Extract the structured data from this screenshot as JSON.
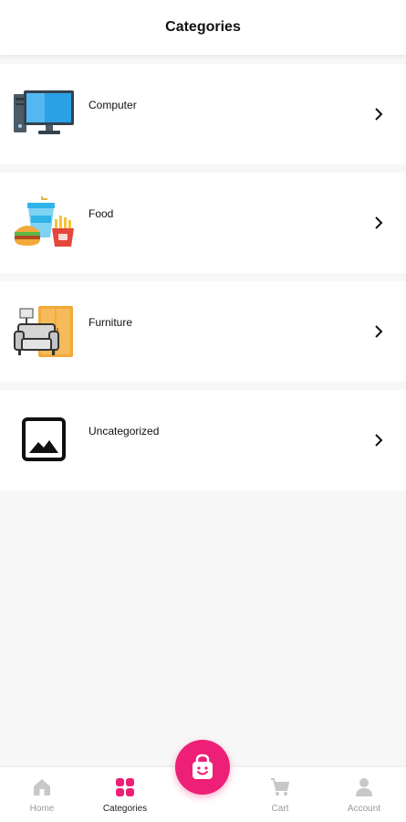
{
  "header": {
    "title": "Categories"
  },
  "categories": [
    {
      "label": "Computer",
      "icon": "computer-icon"
    },
    {
      "label": "Food",
      "icon": "food-icon"
    },
    {
      "label": "Furniture",
      "icon": "furniture-icon"
    },
    {
      "label": "Uncategorized",
      "icon": "image-placeholder-icon"
    }
  ],
  "bottom_nav": {
    "items": [
      {
        "label": "Home",
        "icon": "home-icon",
        "active": false
      },
      {
        "label": "Categories",
        "icon": "grid-icon",
        "active": true
      },
      {
        "label": "Cart",
        "icon": "cart-icon",
        "active": false
      },
      {
        "label": "Account",
        "icon": "account-icon",
        "active": false
      }
    ],
    "fab_icon": "shopping-bag-icon"
  },
  "colors": {
    "accent": "#ee1f76",
    "inactive": "#c8c8c8",
    "background": "#f7f7f7"
  }
}
